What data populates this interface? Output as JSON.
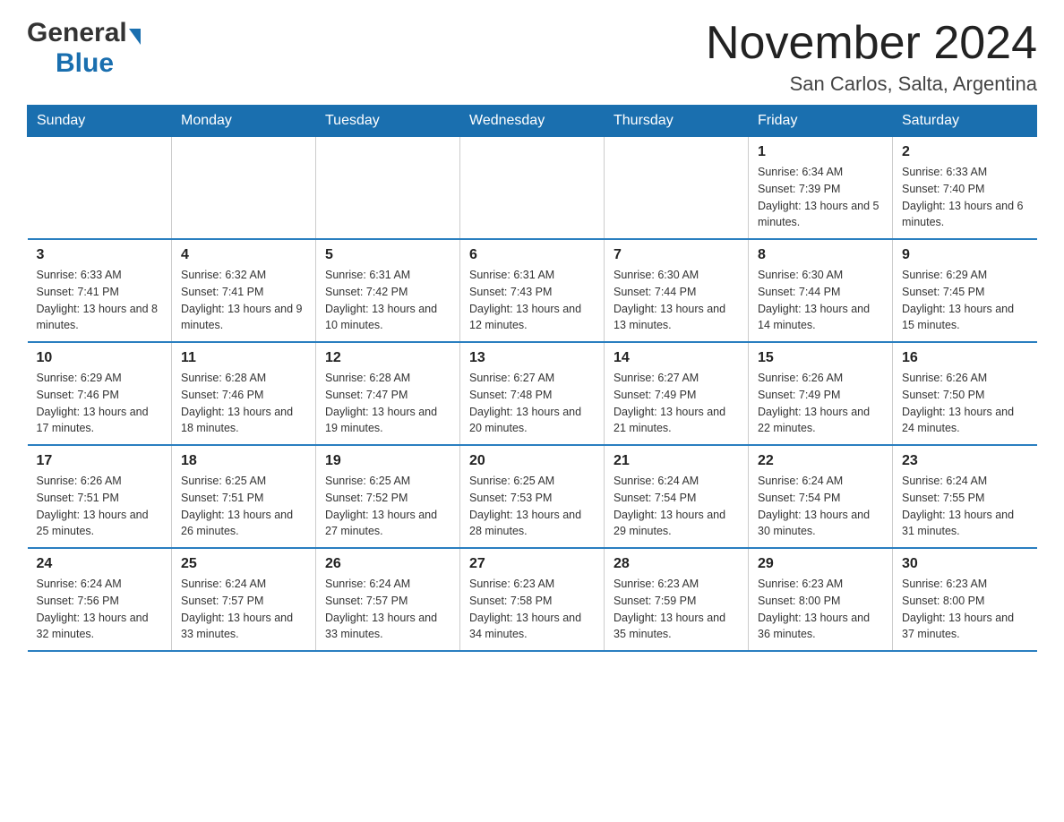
{
  "header": {
    "logo_general": "General",
    "logo_blue": "Blue",
    "main_title": "November 2024",
    "subtitle": "San Carlos, Salta, Argentina"
  },
  "calendar": {
    "days_of_week": [
      "Sunday",
      "Monday",
      "Tuesday",
      "Wednesday",
      "Thursday",
      "Friday",
      "Saturday"
    ],
    "weeks": [
      [
        {
          "day": "",
          "info": ""
        },
        {
          "day": "",
          "info": ""
        },
        {
          "day": "",
          "info": ""
        },
        {
          "day": "",
          "info": ""
        },
        {
          "day": "",
          "info": ""
        },
        {
          "day": "1",
          "info": "Sunrise: 6:34 AM\nSunset: 7:39 PM\nDaylight: 13 hours and 5 minutes."
        },
        {
          "day": "2",
          "info": "Sunrise: 6:33 AM\nSunset: 7:40 PM\nDaylight: 13 hours and 6 minutes."
        }
      ],
      [
        {
          "day": "3",
          "info": "Sunrise: 6:33 AM\nSunset: 7:41 PM\nDaylight: 13 hours and 8 minutes."
        },
        {
          "day": "4",
          "info": "Sunrise: 6:32 AM\nSunset: 7:41 PM\nDaylight: 13 hours and 9 minutes."
        },
        {
          "day": "5",
          "info": "Sunrise: 6:31 AM\nSunset: 7:42 PM\nDaylight: 13 hours and 10 minutes."
        },
        {
          "day": "6",
          "info": "Sunrise: 6:31 AM\nSunset: 7:43 PM\nDaylight: 13 hours and 12 minutes."
        },
        {
          "day": "7",
          "info": "Sunrise: 6:30 AM\nSunset: 7:44 PM\nDaylight: 13 hours and 13 minutes."
        },
        {
          "day": "8",
          "info": "Sunrise: 6:30 AM\nSunset: 7:44 PM\nDaylight: 13 hours and 14 minutes."
        },
        {
          "day": "9",
          "info": "Sunrise: 6:29 AM\nSunset: 7:45 PM\nDaylight: 13 hours and 15 minutes."
        }
      ],
      [
        {
          "day": "10",
          "info": "Sunrise: 6:29 AM\nSunset: 7:46 PM\nDaylight: 13 hours and 17 minutes."
        },
        {
          "day": "11",
          "info": "Sunrise: 6:28 AM\nSunset: 7:46 PM\nDaylight: 13 hours and 18 minutes."
        },
        {
          "day": "12",
          "info": "Sunrise: 6:28 AM\nSunset: 7:47 PM\nDaylight: 13 hours and 19 minutes."
        },
        {
          "day": "13",
          "info": "Sunrise: 6:27 AM\nSunset: 7:48 PM\nDaylight: 13 hours and 20 minutes."
        },
        {
          "day": "14",
          "info": "Sunrise: 6:27 AM\nSunset: 7:49 PM\nDaylight: 13 hours and 21 minutes."
        },
        {
          "day": "15",
          "info": "Sunrise: 6:26 AM\nSunset: 7:49 PM\nDaylight: 13 hours and 22 minutes."
        },
        {
          "day": "16",
          "info": "Sunrise: 6:26 AM\nSunset: 7:50 PM\nDaylight: 13 hours and 24 minutes."
        }
      ],
      [
        {
          "day": "17",
          "info": "Sunrise: 6:26 AM\nSunset: 7:51 PM\nDaylight: 13 hours and 25 minutes."
        },
        {
          "day": "18",
          "info": "Sunrise: 6:25 AM\nSunset: 7:51 PM\nDaylight: 13 hours and 26 minutes."
        },
        {
          "day": "19",
          "info": "Sunrise: 6:25 AM\nSunset: 7:52 PM\nDaylight: 13 hours and 27 minutes."
        },
        {
          "day": "20",
          "info": "Sunrise: 6:25 AM\nSunset: 7:53 PM\nDaylight: 13 hours and 28 minutes."
        },
        {
          "day": "21",
          "info": "Sunrise: 6:24 AM\nSunset: 7:54 PM\nDaylight: 13 hours and 29 minutes."
        },
        {
          "day": "22",
          "info": "Sunrise: 6:24 AM\nSunset: 7:54 PM\nDaylight: 13 hours and 30 minutes."
        },
        {
          "day": "23",
          "info": "Sunrise: 6:24 AM\nSunset: 7:55 PM\nDaylight: 13 hours and 31 minutes."
        }
      ],
      [
        {
          "day": "24",
          "info": "Sunrise: 6:24 AM\nSunset: 7:56 PM\nDaylight: 13 hours and 32 minutes."
        },
        {
          "day": "25",
          "info": "Sunrise: 6:24 AM\nSunset: 7:57 PM\nDaylight: 13 hours and 33 minutes."
        },
        {
          "day": "26",
          "info": "Sunrise: 6:24 AM\nSunset: 7:57 PM\nDaylight: 13 hours and 33 minutes."
        },
        {
          "day": "27",
          "info": "Sunrise: 6:23 AM\nSunset: 7:58 PM\nDaylight: 13 hours and 34 minutes."
        },
        {
          "day": "28",
          "info": "Sunrise: 6:23 AM\nSunset: 7:59 PM\nDaylight: 13 hours and 35 minutes."
        },
        {
          "day": "29",
          "info": "Sunrise: 6:23 AM\nSunset: 8:00 PM\nDaylight: 13 hours and 36 minutes."
        },
        {
          "day": "30",
          "info": "Sunrise: 6:23 AM\nSunset: 8:00 PM\nDaylight: 13 hours and 37 minutes."
        }
      ]
    ]
  }
}
